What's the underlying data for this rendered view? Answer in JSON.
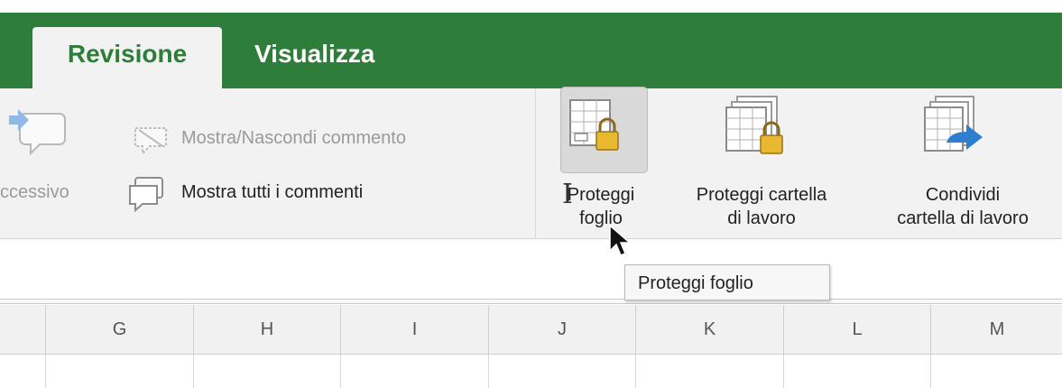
{
  "tabs": [
    {
      "label": "Revisione",
      "active": true
    },
    {
      "label": "Visualizza",
      "active": false
    }
  ],
  "ribbon": {
    "show_hide_comment": "Mostra/Nascondi commento",
    "next_partial": "ccessivo",
    "show_all_comments": "Mostra tutti i commenti",
    "protect_sheet": {
      "line1": "Proteggi",
      "line2": "foglio"
    },
    "protect_workbook": {
      "line1": "Proteggi cartella",
      "line2": "di lavoro"
    },
    "share_workbook": {
      "line1": "Condividi",
      "line2": "cartella di lavoro"
    }
  },
  "tooltip": "Proteggi foglio",
  "columns": [
    "G",
    "H",
    "I",
    "J",
    "K",
    "L",
    "M"
  ],
  "colors": {
    "tab_green": "#2f7d3a",
    "ribbon_bg": "#f2f2f2",
    "lock_gold": "#e8b830",
    "arrow_blue": "#2f7fd0"
  }
}
